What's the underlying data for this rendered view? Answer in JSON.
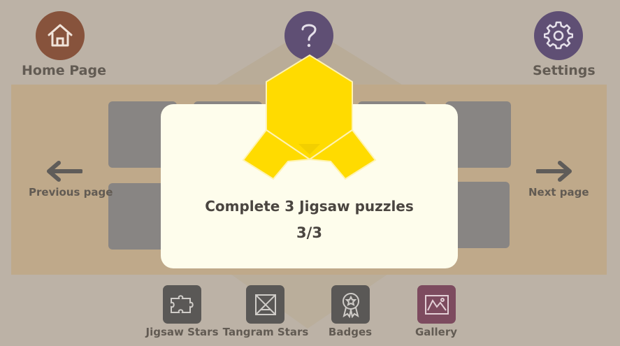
{
  "top_nav": {
    "home_label": "Home Page",
    "settings_label": "Settings",
    "home_icon": "house-icon",
    "help_icon": "question-mark-icon",
    "settings_icon": "gear-icon"
  },
  "pager": {
    "previous_label": "Previous page",
    "next_label": "Next page"
  },
  "bottom_nav": [
    {
      "label": "Jigsaw Stars",
      "icon": "puzzle-piece-icon"
    },
    {
      "label": "Tangram Stars",
      "icon": "tangram-icon"
    },
    {
      "label": "Badges",
      "icon": "badge-icon"
    },
    {
      "label": "Gallery",
      "icon": "picture-icon"
    }
  ],
  "achievement": {
    "title": "Complete 3 Jigsaw puzzles",
    "progress": "3/3"
  },
  "colors": {
    "home": "#87533c",
    "help": "#5f4f74",
    "settings": "#5f4f74",
    "badge_yellow": "#ffdb00",
    "gallery": "#7d4b5f"
  }
}
